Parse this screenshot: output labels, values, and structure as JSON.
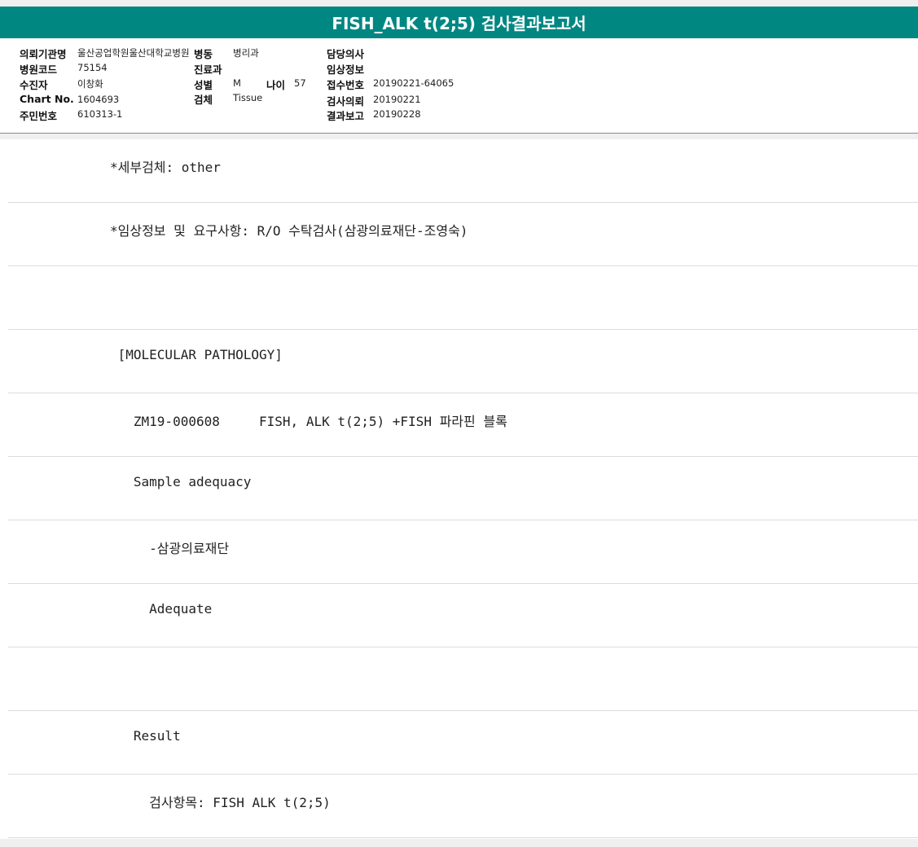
{
  "title": "FISH_ALK t(2;5) 검사결과보고서",
  "info": {
    "institution_label": "의뢰기관명",
    "institution_value": "울산공업학원울산대학교병원",
    "ward_label": "병동",
    "ward_value": "병리과",
    "doctor_label": "담당의사",
    "doctor_value": "",
    "hospital_code_label": "병원코드",
    "hospital_code_value": "75154",
    "department_label": "진료과",
    "department_value": "",
    "clinical_info_label": "임상정보",
    "clinical_info_value": "",
    "patient_label": "수진자",
    "patient_value": "이창화",
    "sex_label": "성별",
    "sex_value": "M",
    "age_label": "나이",
    "age_value": "57",
    "receipt_no_label": "접수번호",
    "receipt_no_value": "20190221-64065",
    "chart_label": "Chart No.",
    "chart_value": "1604693",
    "specimen_label": "검체",
    "specimen_value": "Tissue",
    "request_date_label": "검사의뢰",
    "request_date_value": "20190221",
    "resident_no_label": "주민번호",
    "resident_no_value": "610313-1",
    "report_date_label": "결과보고",
    "report_date_value": "20190228"
  },
  "report_lines": [
    "*세부검체: other",
    "*임상정보 및 요구사항: R/O 수탁검사(삼광의료재단-조영숙)",
    "",
    " [MOLECULAR PATHOLOGY]",
    "   ZM19-000608     FISH, ALK t(2;5) +FISH 파라핀 블록",
    "   Sample adequacy",
    "     -삼광의료재단",
    "     Adequate",
    "",
    "   Result",
    "     검사항목: FISH ALK t(2;5)"
  ]
}
